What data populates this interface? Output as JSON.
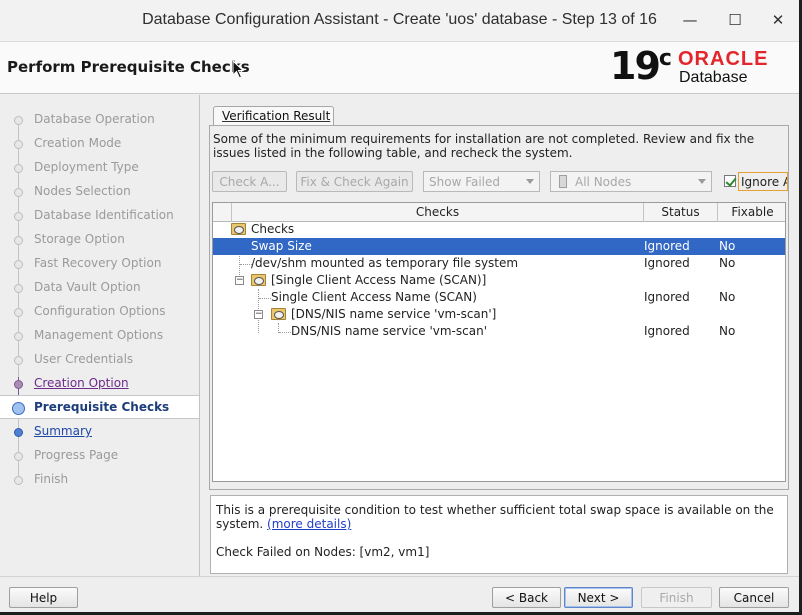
{
  "window": {
    "title": "Database Configuration Assistant - Create 'uos' database - Step 13 of 16",
    "minimize_glyph": "—",
    "maximize_glyph": "☐",
    "close_glyph": "✕"
  },
  "header": {
    "page_title": "Perform Prerequisite Checks",
    "logo_version": "19",
    "logo_version_suffix": "c",
    "logo_brand": "ORACLE",
    "logo_product": "Database",
    "brand_color": "#e3262b"
  },
  "nav": {
    "items": [
      {
        "label": "Database Operation",
        "state": "done"
      },
      {
        "label": "Creation Mode",
        "state": "done"
      },
      {
        "label": "Deployment Type",
        "state": "done"
      },
      {
        "label": "Nodes Selection",
        "state": "done"
      },
      {
        "label": "Database Identification",
        "state": "done"
      },
      {
        "label": "Storage Option",
        "state": "done"
      },
      {
        "label": "Fast Recovery Option",
        "state": "done"
      },
      {
        "label": "Data Vault Option",
        "state": "done"
      },
      {
        "label": "Configuration Options",
        "state": "done"
      },
      {
        "label": "Management Options",
        "state": "done"
      },
      {
        "label": "User Credentials",
        "state": "done"
      },
      {
        "label": "Creation Option",
        "state": "visited-link"
      },
      {
        "label": "Prerequisite Checks",
        "state": "current"
      },
      {
        "label": "Summary",
        "state": "next-link"
      },
      {
        "label": "Progress Page",
        "state": "pending"
      },
      {
        "label": "Finish",
        "state": "pending"
      }
    ]
  },
  "main": {
    "tab_label": "Verification Result",
    "info_text": "Some of the minimum requirements for installation are not completed. Review and fix the issues listed in the following table, and recheck the system.",
    "toolbar": {
      "check_again": "Check A...",
      "fix_check_again": "Fix & Check Again",
      "show_filter": "Show Failed",
      "nodes_filter": "All Nodes",
      "ignore_all": "Ignore All",
      "ignore_all_checked": true
    },
    "table": {
      "columns": [
        "Checks",
        "Status",
        "Fixable"
      ],
      "rows": [
        {
          "name": "Checks",
          "status": "",
          "fixable": ""
        },
        {
          "name": "Swap Size",
          "status": "Ignored",
          "fixable": "No",
          "selected": true
        },
        {
          "name": "/dev/shm mounted as temporary file system",
          "status": "Ignored",
          "fixable": "No"
        },
        {
          "name": "[Single Client Access Name (SCAN)]",
          "status": "",
          "fixable": "",
          "expander": "−"
        },
        {
          "name": "Single Client Access Name (SCAN)",
          "status": "Ignored",
          "fixable": "No"
        },
        {
          "name": "[DNS/NIS name service 'vm-scan']",
          "status": "",
          "fixable": "",
          "expander": "−"
        },
        {
          "name": "DNS/NIS name service 'vm-scan'",
          "status": "Ignored",
          "fixable": "No"
        }
      ]
    },
    "description": {
      "text": "This is a prerequisite condition to test whether sufficient total swap space is available on the system.",
      "more_link": "(more details)",
      "failed_nodes": "Check Failed on Nodes: [vm2, vm1]"
    }
  },
  "footer": {
    "help": "Help",
    "back": "< Back",
    "next": "Next >",
    "finish": "Finish",
    "cancel": "Cancel"
  }
}
